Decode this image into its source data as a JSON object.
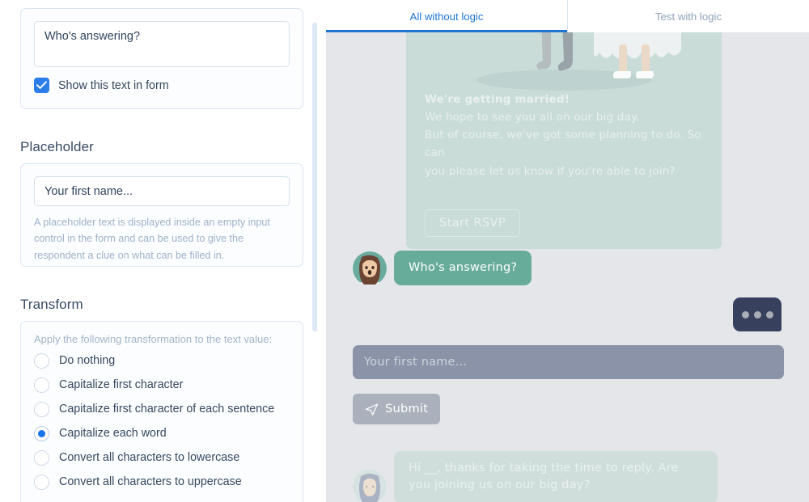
{
  "left": {
    "question": {
      "value": "Who's answering?",
      "show_in_form_label": "Show this text in form",
      "show_in_form_checked": true,
      "checkbox_color": "#2b7de9"
    },
    "placeholder": {
      "title": "Placeholder",
      "value": "Your first name...",
      "help": "A placeholder text is displayed inside an empty input control in the form and can be used to give the respondent a clue on what can be filled in."
    },
    "transform": {
      "title": "Transform",
      "apply_label": "Apply the following transformation to the text value:",
      "selected_index": 3,
      "accent_color": "#1a73e8",
      "options": [
        "Do nothing",
        "Capitalize first character",
        "Capitalize first character of each sentence",
        "Capitalize each word",
        "Convert all characters to lowercase",
        "Convert all characters to uppercase"
      ]
    }
  },
  "right": {
    "tabs": [
      {
        "label": "All without logic",
        "active": true
      },
      {
        "label": "Test with logic",
        "active": false
      }
    ],
    "active_tab_color": "#2076d2",
    "preview": {
      "background": "#e4e6e9",
      "invite": {
        "card_color": "#c9dcd8",
        "heading": "We're getting married!",
        "line2": "We hope to see you all on our big day.",
        "line3": "But of course, we've got some planning to do. So can",
        "line4": "you please let us know if you're able to join?",
        "cta_label": "Start RSVP"
      },
      "messages": [
        {
          "text": "Who's answering?",
          "style": "bot-active",
          "avatar": "woman-brown-hair-avatar"
        },
        {
          "text": "Hi __, thanks for taking the time to reply. Are you joining us on our big day?",
          "style": "bot-faded",
          "avatar": "woman-headscarf-avatar"
        }
      ],
      "typing_indicator": {
        "name": "typing-indicator",
        "color": "#37405c",
        "dots": 3
      },
      "answer_input": {
        "placeholder": "Your first name...",
        "value": "",
        "color": "#8a93a7"
      },
      "submit": {
        "label": "Submit",
        "icon": "paper-plane-icon",
        "color": "#aab1bd"
      }
    }
  }
}
